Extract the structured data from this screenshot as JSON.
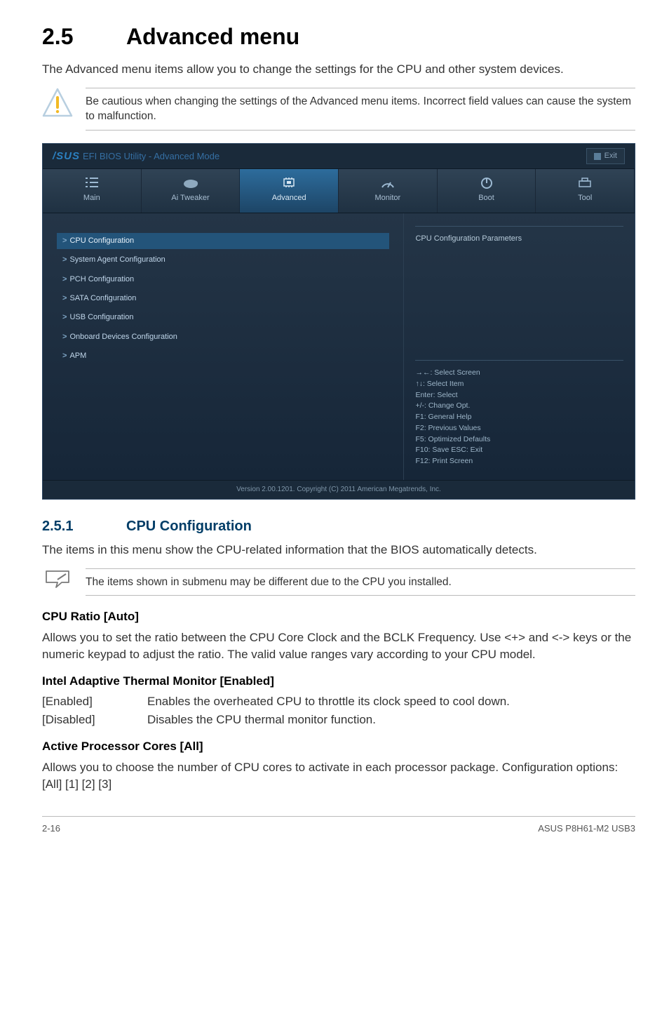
{
  "section": {
    "num": "2.5",
    "title": "Advanced menu"
  },
  "intro": "The Advanced menu items allow you to change the settings for the CPU and other system devices.",
  "caution": "Be cautious when changing the settings of the Advanced menu items. Incorrect field values can cause the system to malfunction.",
  "bios": {
    "brand": "/SUS",
    "utility": "EFI BIOS Utility - Advanced Mode",
    "exit": "Exit",
    "tabs": [
      "Main",
      "Ai Tweaker",
      "Advanced",
      "Monitor",
      "Boot",
      "Tool"
    ],
    "active_tab": 2,
    "menu": [
      "CPU Configuration",
      "System Agent Configuration",
      "PCH Configuration",
      "SATA Configuration",
      "USB Configuration",
      "Onboard Devices Configuration",
      "APM"
    ],
    "selected_menu": 0,
    "info_panel": "CPU Configuration Parameters",
    "hints": [
      "→←: Select Screen",
      "↑↓: Select Item",
      "Enter: Select",
      "+/-: Change Opt.",
      "F1: General Help",
      "F2: Previous Values",
      "F5: Optimized Defaults",
      "F10: Save   ESC: Exit",
      "F12: Print Screen"
    ],
    "footer": "Version 2.00.1201.  Copyright (C) 2011 American Megatrends, Inc."
  },
  "sub": {
    "num": "2.5.1",
    "title": "CPU Configuration"
  },
  "sub_intro": "The items in this menu show the CPU-related information that the BIOS automatically detects.",
  "note": "The items shown in submenu may be different due to the CPU you installed.",
  "cpu_ratio": {
    "heading": "CPU Ratio [Auto]",
    "body": "Allows you to set the ratio between the CPU Core Clock and the BCLK Frequency. Use <+> and <-> keys or the numeric keypad to adjust the ratio. The valid value ranges vary according to your CPU model."
  },
  "thermal": {
    "heading": "Intel Adaptive Thermal Monitor [Enabled]",
    "options": [
      {
        "k": "[Enabled]",
        "v": "Enables the overheated CPU to throttle its clock speed to cool down."
      },
      {
        "k": "[Disabled]",
        "v": "Disables the CPU thermal monitor function."
      }
    ]
  },
  "cores": {
    "heading": "Active Processor Cores [All]",
    "body": "Allows you to choose the number of CPU cores to activate in each processor package. Configuration options: [All] [1] [2] [3]"
  },
  "footer": {
    "page": "2-16",
    "product": "ASUS P8H61-M2 USB3"
  }
}
